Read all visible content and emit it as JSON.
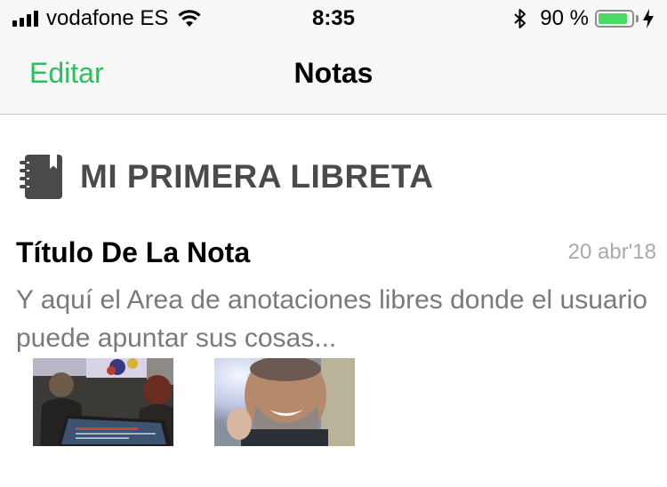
{
  "status_bar": {
    "carrier": "vodafone ES",
    "time": "8:35",
    "battery_percent": "90 %",
    "battery_level": 0.9
  },
  "nav": {
    "edit_label": "Editar",
    "title": "Notas"
  },
  "notebook": {
    "title": "MI PRIMERA LIBRETA",
    "icon": "notebook-icon"
  },
  "note": {
    "title": "Título De La Nota",
    "date": "20 abr'18",
    "body": "Y aquí el Area de anotaciones libres donde el usuario puede apuntar sus cosas...",
    "thumbnails": [
      {
        "name": "photo-thumbnail-classroom"
      },
      {
        "name": "photo-thumbnail-selfie"
      }
    ]
  },
  "colors": {
    "accent": "#2dbe60",
    "battery": "#4cd964",
    "heading_gray": "#4a4a4a",
    "body_gray": "#7a7a7a",
    "date_gray": "#a9a9a9"
  }
}
